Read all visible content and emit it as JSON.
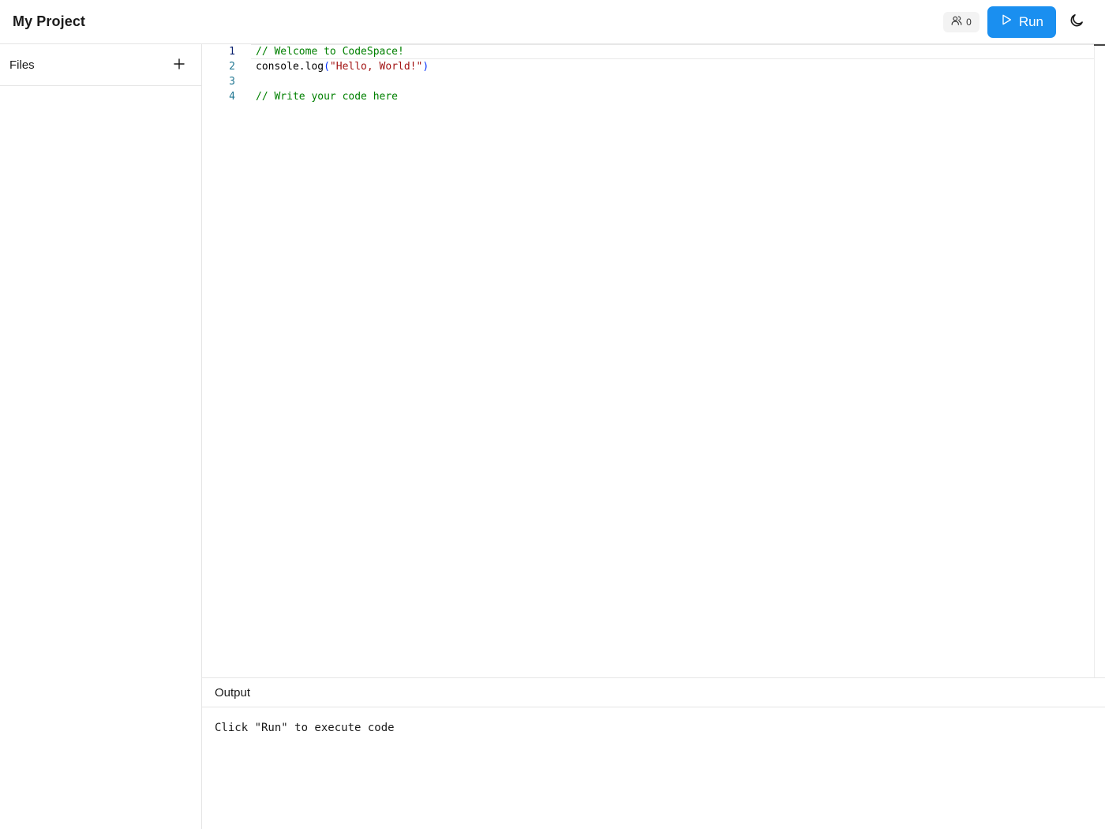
{
  "header": {
    "title": "My Project",
    "users_count": "0",
    "users_icon": "users-icon",
    "run_label": "Run",
    "run_icon": "play-icon",
    "theme_icon": "moon-icon",
    "accent_color": "#1a8ff0"
  },
  "sidebar": {
    "title": "Files",
    "add_icon": "plus-icon"
  },
  "editor": {
    "line_numbers": [
      "1",
      "2",
      "3",
      "4"
    ],
    "lines": [
      {
        "tokens": [
          {
            "text": "// Welcome to CodeSpace!",
            "kind": "comment"
          }
        ]
      },
      {
        "tokens": [
          {
            "text": "console.log",
            "kind": "plain"
          },
          {
            "text": "(",
            "kind": "paren"
          },
          {
            "text": "\"Hello, World!\"",
            "kind": "string"
          },
          {
            "text": ")",
            "kind": "paren"
          }
        ]
      },
      {
        "tokens": []
      },
      {
        "tokens": [
          {
            "text": "// Write your code here",
            "kind": "comment"
          }
        ]
      }
    ]
  },
  "output": {
    "title": "Output",
    "message": "Click \"Run\" to execute code"
  }
}
